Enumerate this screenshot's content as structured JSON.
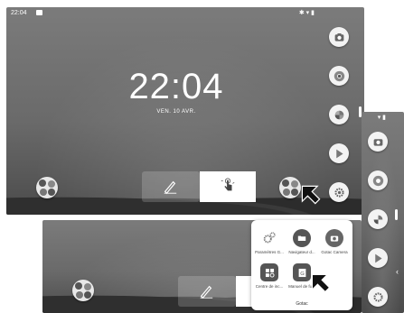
{
  "status": {
    "time": "22:04"
  },
  "lockscreen": {
    "clock": "22:04",
    "date": "VEN. 10 AVR."
  },
  "folder": {
    "name": "Gotac",
    "apps": [
      {
        "label": "Paramètres G...",
        "icon": "gear-icon"
      },
      {
        "label": "Navigateur d...",
        "icon": "folder-icon"
      },
      {
        "label": "Gotac Camera",
        "icon": "camera-icon"
      },
      {
        "label": "Centre de inc...",
        "icon": "grid-icon"
      },
      {
        "label": "Manuel de fu...",
        "icon": "manual-icon"
      }
    ]
  },
  "colors": {
    "wallpaper": "#6e6e6e",
    "icon_bg": "#f3f3f3",
    "icon_fg": "#555555"
  }
}
